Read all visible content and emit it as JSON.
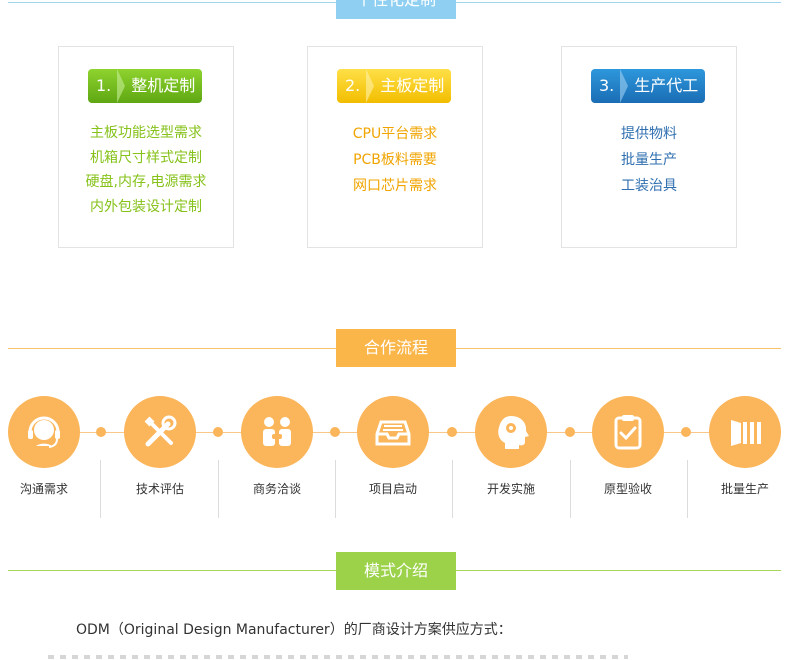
{
  "sections": {
    "custom": "个性化定制",
    "process": "合作流程",
    "mode": "模式介绍"
  },
  "cards": [
    {
      "num": "1.",
      "title": "整机定制",
      "items": [
        "主板功能选型需求",
        "机箱尺寸样式定制",
        "硬盘,内存,电源需求",
        "内外包装设计定制"
      ],
      "color": "#86c21a"
    },
    {
      "num": "2.",
      "title": "主板定制",
      "items": [
        "CPU平台需求",
        "PCB板料需要",
        "网口芯片需求"
      ],
      "color": "#f0a400"
    },
    {
      "num": "3.",
      "title": "生产代工",
      "items": [
        "提供物料",
        "批量生产",
        "工装治具"
      ],
      "color": "#2f6fb0"
    }
  ],
  "steps": [
    {
      "label": "沟通需求",
      "icon": "headset-icon"
    },
    {
      "label": "技术评估",
      "icon": "tools-icon"
    },
    {
      "label": "商务洽谈",
      "icon": "handshake-icon"
    },
    {
      "label": "项目启动",
      "icon": "tray-icon"
    },
    {
      "label": "开发实施",
      "icon": "brain-gear-icon"
    },
    {
      "label": "原型验收",
      "icon": "clipboard-check-icon"
    },
    {
      "label": "批量生产",
      "icon": "factory-icon"
    }
  ],
  "intro": "ODM（Original Design Manufacturer）的厂商设计方案供应方式：",
  "colors": {
    "orange": "#fbb55a",
    "green": "#9bd24a",
    "blue": "#8fd0f2"
  }
}
